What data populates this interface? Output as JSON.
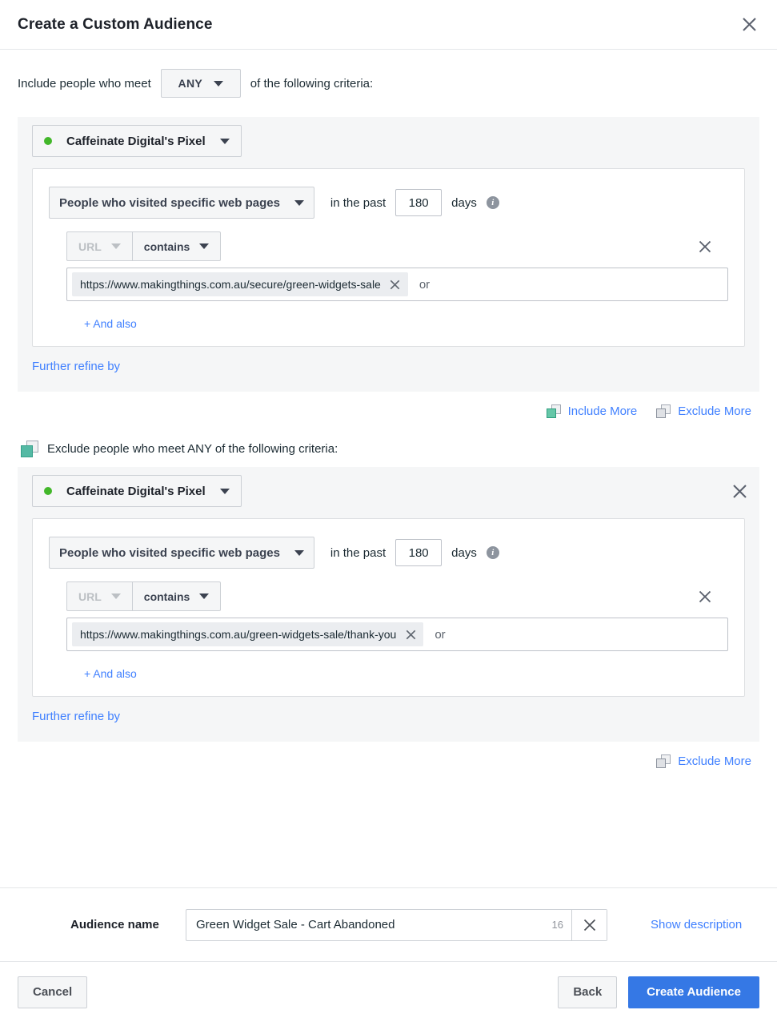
{
  "dialog": {
    "title": "Create a Custom Audience",
    "close_icon": "close-icon"
  },
  "include": {
    "prefix_label": "Include people who meet",
    "match_operator": "ANY",
    "suffix_label": "of the following criteria:",
    "group": {
      "pixel_name": "Caffeinate Digital's Pixel",
      "status_color": "#42b72a",
      "event": "People who visited specific web pages",
      "past_label": "in the past",
      "days_value": "180",
      "days_label": "days",
      "info_icon": "info-icon",
      "condition": {
        "field": "URL",
        "operator": "contains",
        "token": "https://www.makingthings.com.au/secure/green-widgets-sale",
        "placeholder": "or"
      },
      "and_also": "+ And also",
      "further_refine": "Further refine by"
    }
  },
  "more_links": {
    "include_more": "Include More",
    "exclude_more": "Exclude More"
  },
  "exclude": {
    "header": "Exclude people who meet ANY of the following criteria:",
    "group": {
      "pixel_name": "Caffeinate Digital's Pixel",
      "status_color": "#42b72a",
      "event": "People who visited specific web pages",
      "past_label": "in the past",
      "days_value": "180",
      "days_label": "days",
      "info_icon": "info-icon",
      "condition": {
        "field": "URL",
        "operator": "contains",
        "token": "https://www.makingthings.com.au/green-widgets-sale/thank-you",
        "placeholder": "or"
      },
      "and_also": "+ And also",
      "further_refine": "Further refine by"
    },
    "exclude_more": "Exclude More"
  },
  "audience_name": {
    "label": "Audience name",
    "value": "Green Widget Sale - Cart Abandoned",
    "char_count": "16",
    "clear_icon": "close-icon",
    "show_description": "Show description"
  },
  "footer": {
    "cancel": "Cancel",
    "back": "Back",
    "create": "Create Audience",
    "primary_color": "#3578e5"
  }
}
